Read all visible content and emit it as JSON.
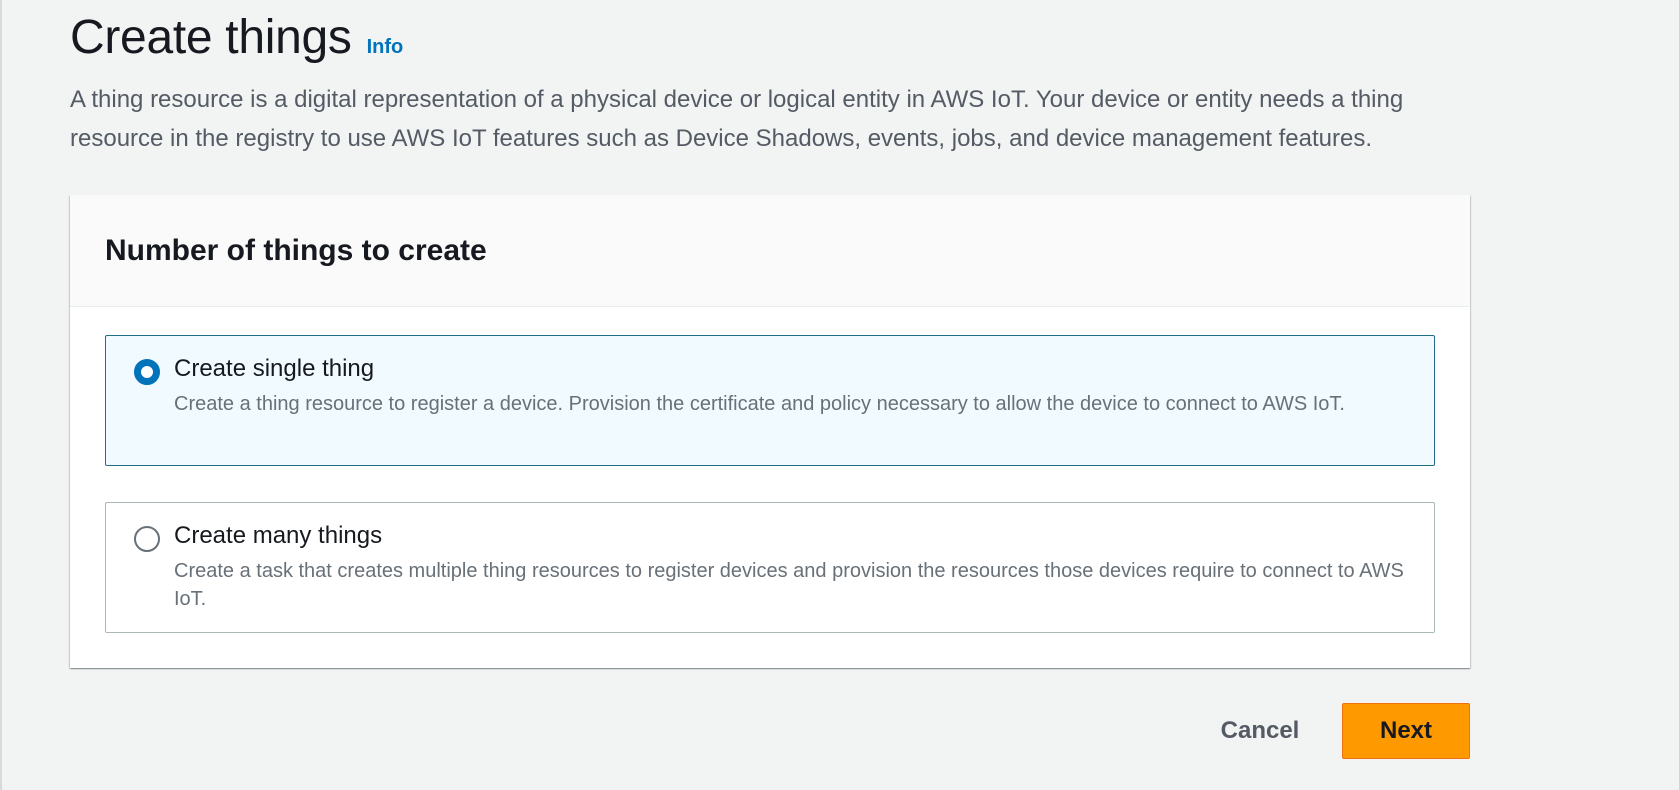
{
  "header": {
    "title": "Create things",
    "info_label": "Info",
    "description": "A thing resource is a digital representation of a physical device or logical entity in AWS IoT. Your device or entity needs a thing resource in the registry to use AWS IoT features such as Device Shadows, events, jobs, and device management features."
  },
  "card": {
    "title": "Number of things to create",
    "options": [
      {
        "label": "Create single thing",
        "description": "Create a thing resource to register a device. Provision the certificate and policy necessary to allow the device to connect to AWS IoT.",
        "selected": true
      },
      {
        "label": "Create many things",
        "description": "Create a task that creates multiple thing resources to register devices and provision the resources those devices require to connect to AWS IoT.",
        "selected": false
      }
    ]
  },
  "actions": {
    "cancel_label": "Cancel",
    "next_label": "Next"
  },
  "colors": {
    "accent": "#0073bb",
    "primary_button": "#ff9900",
    "background": "#f2f3f3"
  }
}
